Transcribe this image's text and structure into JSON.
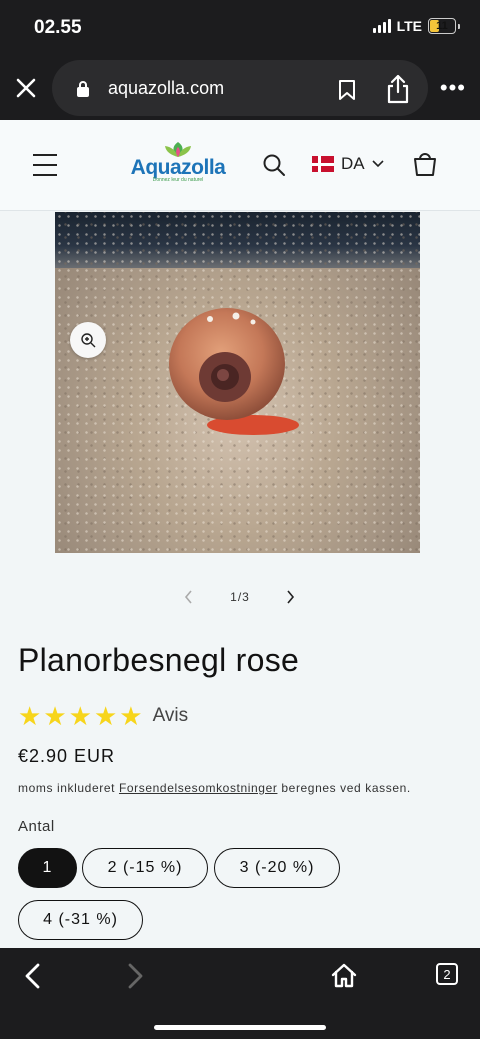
{
  "status_bar": {
    "time": "02.55",
    "network": "LTE",
    "battery": "11"
  },
  "browser": {
    "url": "aquazolla.com"
  },
  "header": {
    "logo_text": "Aquazolla",
    "logo_tagline": "Donnez leur du naturel",
    "language_code": "DA"
  },
  "gallery": {
    "counter": "1/3"
  },
  "product": {
    "title": "Planorbesnegl rose",
    "rating_stars": 5,
    "rating_label": "Avis",
    "price": "€2.90 EUR",
    "tax_prefix": "moms inkluderet",
    "tax_link": "Forsendelsesomkostninger",
    "tax_suffix": "beregnes ved kassen.",
    "quantity_label": "Antal",
    "quantity_options": [
      "1",
      "2 (-15 %)",
      "3 (-20 %)",
      "4 (-31 %)"
    ],
    "selected_option": "1"
  },
  "toolbar": {
    "tab_count": "2"
  },
  "colors": {
    "star": "#f7d51b",
    "logo_blue": "#1d74b8",
    "dark": "#121212",
    "page_bg": "#f2f6f7"
  }
}
